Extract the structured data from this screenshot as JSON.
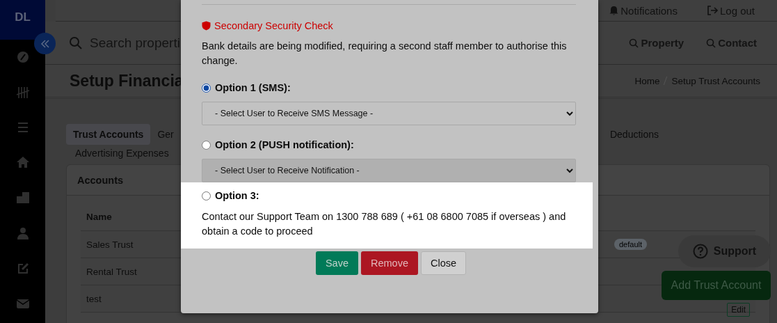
{
  "sidebar": {
    "logo": "DL"
  },
  "header": {
    "links": [
      {
        "label": "Notifications",
        "kind": "bell"
      },
      {
        "label": "Log out",
        "kind": "logout"
      }
    ]
  },
  "search": {
    "placeholder": "Search properti",
    "links": [
      "Property",
      "Contact"
    ]
  },
  "page": {
    "title": "Setup Financia",
    "breadcrumbs": [
      "Home",
      "Setup Trust Accounts"
    ]
  },
  "tabs": [
    {
      "label": "Trust Accounts",
      "selected": true
    },
    {
      "label": "Ger",
      "selected": false
    },
    {
      "label": "Deductions",
      "selected": false
    },
    {
      "label": "Advertising Expenses",
      "selected": false
    }
  ],
  "card": {
    "title": "Accounts",
    "columns": [
      "Name"
    ],
    "rows": [
      {
        "name": "Sales Trust",
        "badge": "default"
      },
      {
        "name": "Rental Trust"
      },
      {
        "name": "test",
        "action": "Edit"
      }
    ]
  },
  "support_button": "Support",
  "add_button": "Add Trust Account",
  "dialog": {
    "title": "Secondary Security Check",
    "message": "Bank details are being modified, requiring a second staff member to authorise this change.",
    "options": [
      {
        "label": "Option 1 (SMS):",
        "selected": true,
        "select": {
          "value": "- Select User to Receive SMS Message -",
          "disabled": false
        }
      },
      {
        "label": "Option 2 (PUSH notification):",
        "selected": false,
        "select": {
          "value": "- Select User to Receive Notification -",
          "disabled": true
        }
      },
      {
        "label": "Option 3:",
        "selected": false,
        "highlighted": true,
        "text": "Contact our Support Team on 1300 788 689 ( +61 08 6800 7085 if overseas ) and obtain a code to proceed"
      }
    ],
    "buttons": [
      {
        "label": "Save",
        "kind": "save"
      },
      {
        "label": "Remove",
        "kind": "remove"
      },
      {
        "label": "Close",
        "kind": "close"
      }
    ]
  }
}
